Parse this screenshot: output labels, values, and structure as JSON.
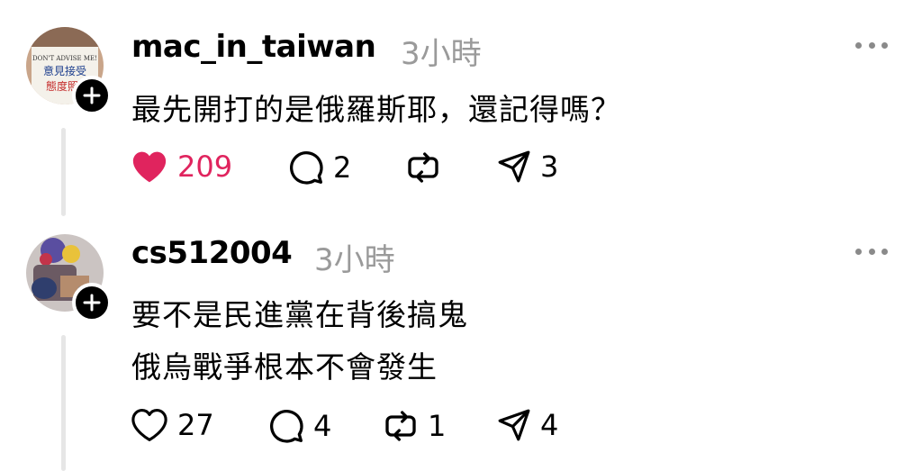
{
  "posts": [
    {
      "username": "mac_in_taiwan",
      "time": "3小時",
      "avatar_text": [
        "DON'T ADVISE ME!",
        "意見接受",
        "態度照"
      ],
      "lines": [
        "最先開打的是俄羅斯耶，還記得嗎？"
      ],
      "likes": "209",
      "liked": true,
      "replies": "2",
      "reposts": "",
      "shares": "3"
    },
    {
      "username": "cs512004",
      "time": "3小時",
      "lines": [
        "要不是民進黨在背後搞鬼",
        "俄烏戰爭根本不會發生"
      ],
      "likes": "27",
      "liked": false,
      "replies": "4",
      "reposts": "1",
      "shares": "4"
    }
  ],
  "colors": {
    "like_active": "#e0245e",
    "muted": "#9a9a9a",
    "thread_line": "#e6e6e6"
  },
  "icons": [
    "heart-icon",
    "comment-icon",
    "repost-icon",
    "share-icon",
    "more-icon",
    "plus-icon"
  ]
}
